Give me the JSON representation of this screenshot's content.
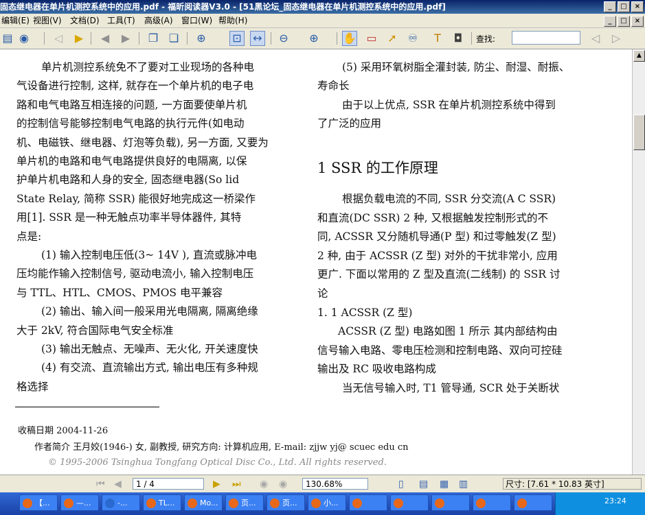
{
  "window": {
    "title": "固态继电器在单片机测控系统中的应用.pdf - 福昕阅读器V3.0 - [51黑论坛_固态继电器在单片机测控系统中的应用.pdf]",
    "min": "_",
    "max": "□",
    "close": "×"
  },
  "menu": [
    "编辑(E)",
    "视图(V)",
    "文档(D)",
    "工具(T)",
    "高级(A)",
    "窗口(W)",
    "帮助(H)"
  ],
  "toolbar": {
    "find_label": "查找:",
    "find_value": ""
  },
  "document": {
    "left_lines": [
      "单片机测控系统免不了要对工业现场的各种电",
      "气设备进行控制, 这样, 就存在一个单片机的电子电",
      "路和电气电路互相连接的问题, 一方面要使单片机",
      "的控制信号能够控制电气电路的执行元件(如电动",
      "机、电磁铁、继电器、灯泡等负载), 另一方面, 又要为",
      "单片机的电路和电气电路提供良好的电隔离, 以保",
      "护单片机电路和人身的安全, 固态继电器(So lid",
      "State Relay, 简称 SSR) 能很好地完成这一桥梁作",
      "用[1]. SSR 是一种无触点功率半导体器件, 其特",
      "点是:",
      "(1) 输入控制电压低(3~ 14V ), 直流或脉冲电",
      "压均能作输入控制信号, 驱动电流小, 输入控制电压",
      "与 TTL、HTL、CMOS、PMOS 电平兼容",
      "(2) 输出、输入间一般采用光电隔离, 隔离绝缘",
      "大于 2kV, 符合国际电气安全标准",
      "(3) 输出无触点、无噪声、无火化, 开关速度快",
      "(4) 有交流、直流输出方式, 输出电压有多种规",
      "格选择"
    ],
    "right_lines_top": [
      "(5) 采用环氧树脂全灌封装, 防尘、耐湿、耐振、",
      "寿命长",
      "由于以上优点, SSR 在单片机测控系统中得到",
      "了广泛的应用"
    ],
    "heading": "1  SSR 的工作原理",
    "right_lines_bottom": [
      "根据负载电流的不同, SSR 分交流(A C SSR)",
      "和直流(DC SSR) 2 种, 又根据触发控制形式的不",
      "同, ACSSR 又分随机导通(P 型) 和过零触发(Z 型)",
      "2 种, 由于 ACSSR (Z 型) 对外的干扰非常小, 应用",
      "更广. 下面以常用的 Z 型及直流(二线制) 的 SSR 讨",
      "论",
      "1. 1  ACSSR (Z 型)",
      "ACSSR (Z 型) 电路如图 1 所示  其内部结构由",
      "信号输入电路、零电压检测和控制电路、双向可控硅",
      "输出及 RC 吸收电路构成",
      "当无信号输入时, T1 管导通, SCR 处于关断状"
    ],
    "footnote_received": "收稿日期    2004-11-26",
    "footnote_author": "作者简介    王月姣(1946-) 女, 副教授, 研究方向: 计算机应用, E-mail: zjjw yj@ scuec edu cn",
    "copyright": "© 1995-2006 Tsinghua Tongfang Optical Disc Co., Ltd.    All rights reserved."
  },
  "status": {
    "page": "1 / 4",
    "zoom": "130.68%",
    "size": "尺寸: [7.61 * 10.83 英寸]"
  },
  "taskbar": {
    "tasks": [
      "【...",
      "—...",
      "-...",
      "TL...",
      "Mo...",
      "页...",
      "页...",
      "小..."
    ],
    "time": "23:24"
  }
}
